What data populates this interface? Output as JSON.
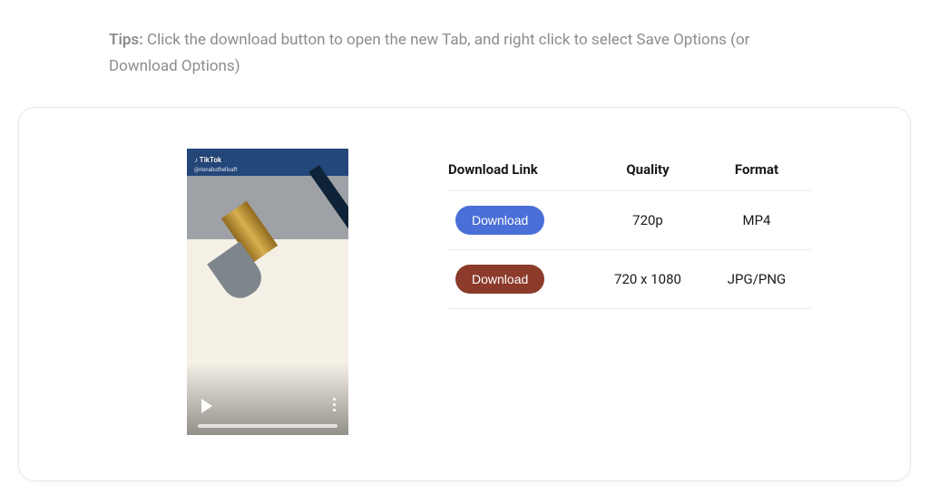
{
  "tips": {
    "label": "Tips:",
    "text": "Click the download button to open the new Tab, and right click to select Save Options (or Download Options)"
  },
  "thumbnail": {
    "watermark": "♪ TikTok",
    "username": "@rionabuthelloaft"
  },
  "table": {
    "headers": {
      "link": "Download Link",
      "quality": "Quality",
      "format": "Format"
    },
    "rows": [
      {
        "button_label": "Download",
        "button_color": "blue",
        "quality": "720p",
        "format": "MP4"
      },
      {
        "button_label": "Download",
        "button_color": "brown",
        "quality": "720 x 1080",
        "format": "JPG/PNG"
      }
    ]
  }
}
